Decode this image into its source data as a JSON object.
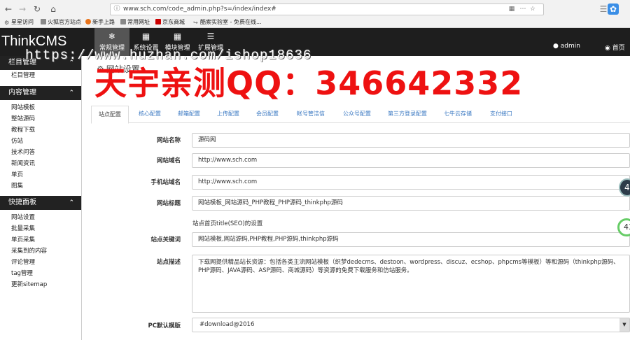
{
  "browser": {
    "url": "www.sch.com/code_admin.php?s=/index/index#",
    "bookmarks": [
      "星星访问",
      "火狐官方站点",
      "新手上路",
      "常用网址",
      "京东商城",
      "酷索实验室 - 免费在线..."
    ]
  },
  "header": {
    "brand": "ThinkCMS",
    "nav": [
      {
        "label": "常规管理",
        "icon": "snowflake-icon"
      },
      {
        "label": "系统设置",
        "icon": "grid-icon"
      },
      {
        "label": "模块管理",
        "icon": "grid-icon"
      },
      {
        "label": "扩展管理",
        "icon": "list-icon"
      }
    ],
    "user": "admin",
    "home": "首页"
  },
  "sidebar": {
    "sections": [
      {
        "title": "栏目管理",
        "items": [
          "栏目管理"
        ]
      },
      {
        "title": "内容管理",
        "items": [
          "网站模板",
          "整站源码",
          "教程下载",
          "仿站",
          "技术问答",
          "新闻资讯",
          "单页",
          "图集"
        ]
      },
      {
        "title": "快捷面板",
        "items": [
          "网站设置",
          "批量采集",
          "单页采集",
          "采集到的内容",
          "评论管理",
          "tag管理",
          "更新sitemap"
        ]
      }
    ]
  },
  "main": {
    "page_title": "网站设置",
    "tabs": [
      "站点配置",
      "核心配置",
      "邮箱配置",
      "上传配置",
      "会员配置",
      "帐号管洁信",
      "公众号配置",
      "第三方登录配置",
      "七牛云存储",
      "支付接口"
    ],
    "form": {
      "site_name": {
        "label": "网站名称",
        "value": "源码网"
      },
      "site_domain": {
        "label": "网站域名",
        "value": "http://www.sch.com"
      },
      "mobile_domain": {
        "label": "手机站域名",
        "value": "http://www.sch.com"
      },
      "site_title": {
        "label": "网站标题",
        "value": "网站模板_网站源码_PHP教程_PHP源码_thinkphp源码",
        "help": "站点首页title(SEO)的设置"
      },
      "keywords": {
        "label": "站点关键词",
        "value": "网站模板,网站源码,PHP教程,PHP源码,thinkphp源码"
      },
      "description": {
        "label": "站点描述",
        "value": "下载网提供精品站长资源：包括各类主流网站模板（织梦dedecms、destoon、wordpress、discuz、ecshop、phpcms等模板）等和源码（thinkphp源码、PHP源码、JAVA源码、ASP源码、商城源码）等资源的免费下载服务和仿站服务。"
      },
      "pc_template": {
        "label": "PC默认模版",
        "value": "#download@2016"
      }
    }
  },
  "watermark": {
    "url": "https://www.huzhan.com/ishop18636",
    "qq": "天宇亲测QQ：346642332"
  },
  "floats": {
    "badge1": "4",
    "badge2": "43"
  }
}
